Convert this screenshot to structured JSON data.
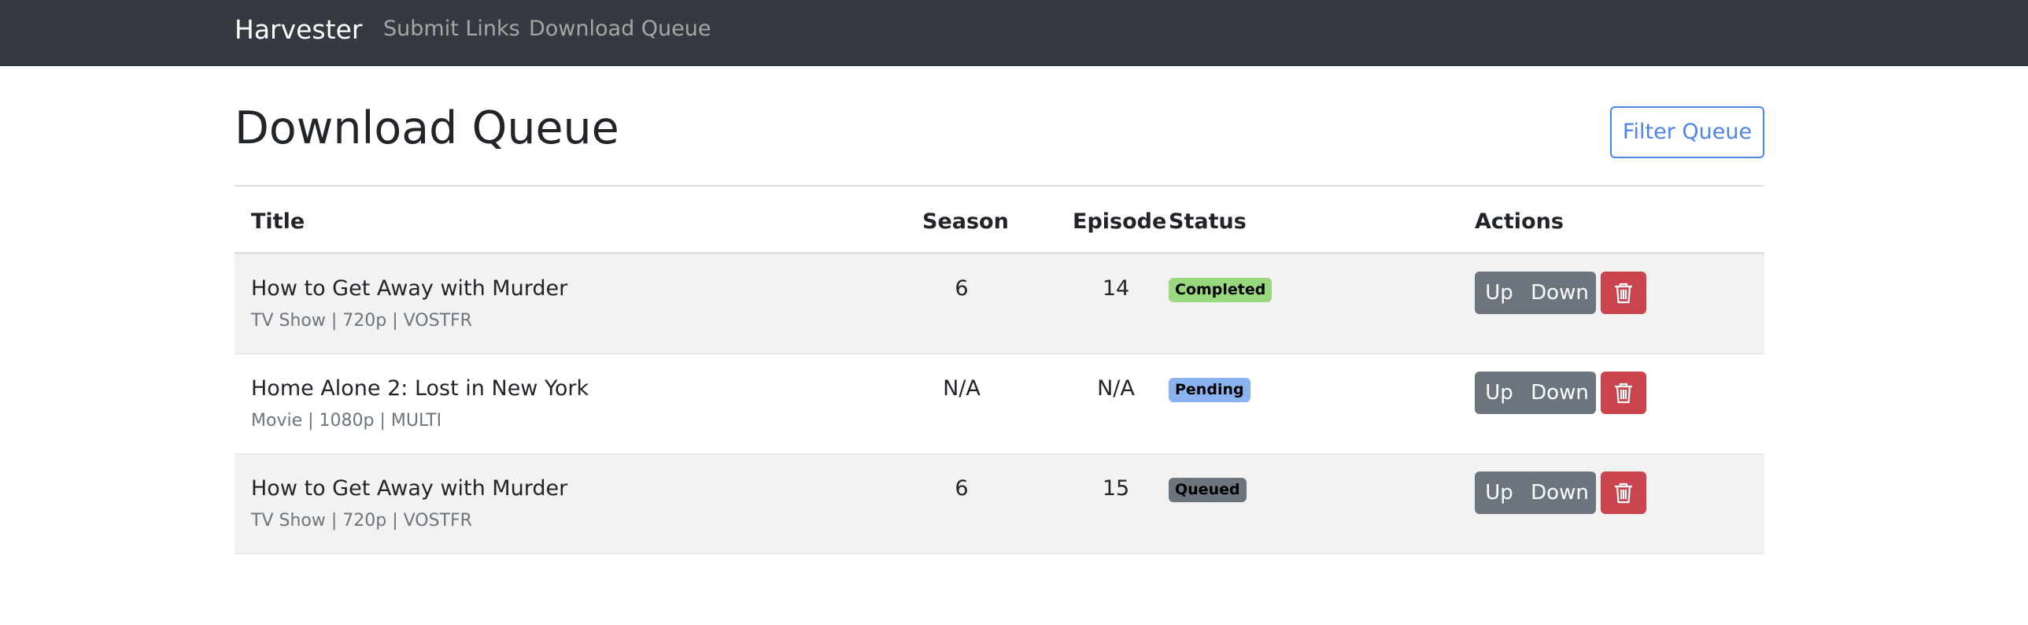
{
  "nav": {
    "brand": "Harvester",
    "links": [
      "Submit Links",
      "Download Queue"
    ]
  },
  "page": {
    "title": "Download Queue",
    "filter_label": "Filter Queue"
  },
  "table": {
    "headers": [
      "Title",
      "Season",
      "Episode",
      "Status",
      "Actions"
    ],
    "rows": [
      {
        "title": "How to Get Away with Murder",
        "meta": "TV Show | 720p | VOSTFR",
        "season": "6",
        "episode": "14",
        "status": "Completed"
      },
      {
        "title": "Home Alone 2: Lost in New York",
        "meta": "Movie | 1080p | MULTI",
        "season": "N/A",
        "episode": "N/A",
        "status": "Pending"
      },
      {
        "title": "How to Get Away with Murder",
        "meta": "TV Show | 720p | VOSTFR",
        "season": "6",
        "episode": "15",
        "status": "Queued"
      }
    ],
    "actions": {
      "up_label": "Up",
      "down_label": "Down",
      "delete_icon": "trash-icon"
    }
  },
  "colors": {
    "navbar": "#343a40",
    "primary": "#4d84e8",
    "secondary": "#6c757d",
    "danger": "#c9444d",
    "completed": "#9ad87f",
    "pending": "#8ab3f0",
    "queued": "#6c757d"
  }
}
